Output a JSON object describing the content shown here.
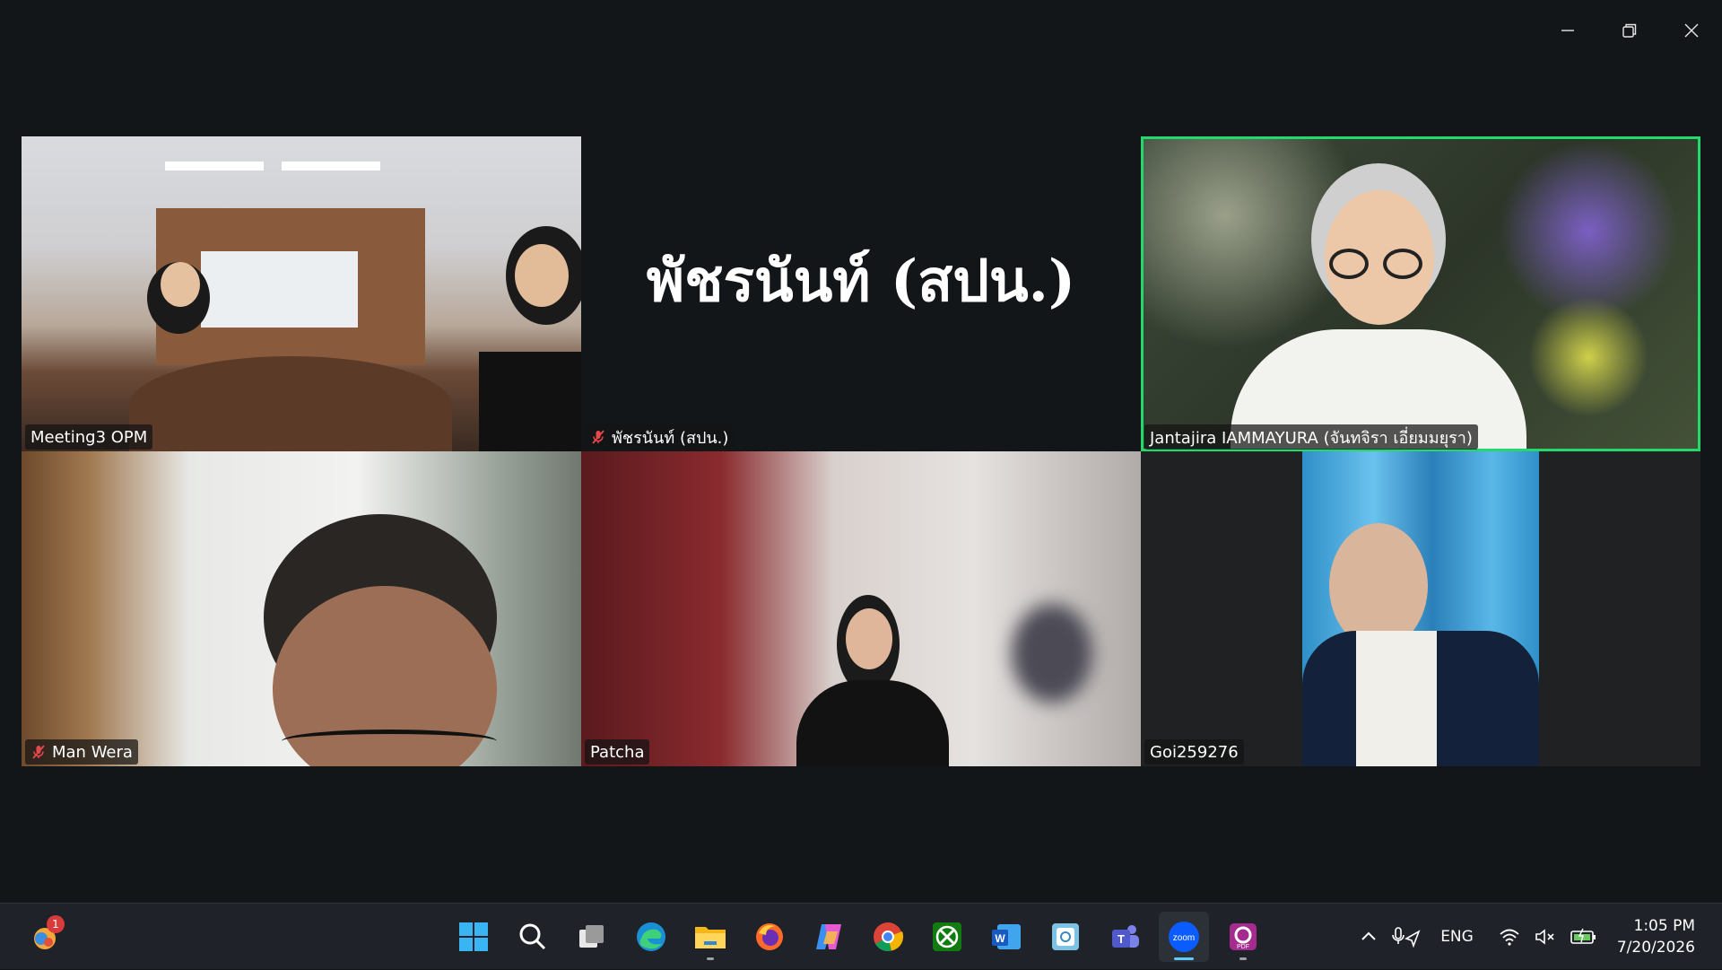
{
  "window": {
    "minimize_icon": "minimize-icon",
    "restore_icon": "restore-icon",
    "close_icon": "close-icon"
  },
  "participants": [
    {
      "name": "Meeting3 OPM",
      "muted": false,
      "video": true
    },
    {
      "name": "พัชรนันท์ (สปน.)",
      "big_name": "พัชรนันท์ (สปน.)",
      "muted": true,
      "video": false
    },
    {
      "name": "Jantajira IAMMAYURA (จันทจิรา เอี่ยมมยุรา)",
      "muted": false,
      "video": true,
      "active_speaker": true
    },
    {
      "name": "Man Wera",
      "muted": true,
      "video": true
    },
    {
      "name": "Patcha",
      "muted": false,
      "video": true
    },
    {
      "name": "Goi259276",
      "muted": false,
      "video": true
    }
  ],
  "colors": {
    "active_speaker": "#23d96c",
    "muted_mic": "#e5484d",
    "background": "#131619"
  },
  "taskbar": {
    "widgets_badge": "1",
    "apps": [
      "start-icon",
      "search-icon",
      "task-view-icon",
      "edge-icon",
      "file-explorer-icon",
      "firefox-icon",
      "copilot-icon",
      "chrome-icon",
      "xbox-icon",
      "word-icon",
      "photos-icon",
      "teams-icon",
      "zoom-icon",
      "pdf-app-icon"
    ],
    "tray": {
      "language": "ENG",
      "time": "1:05 PM",
      "date": "7/20/2026"
    }
  }
}
